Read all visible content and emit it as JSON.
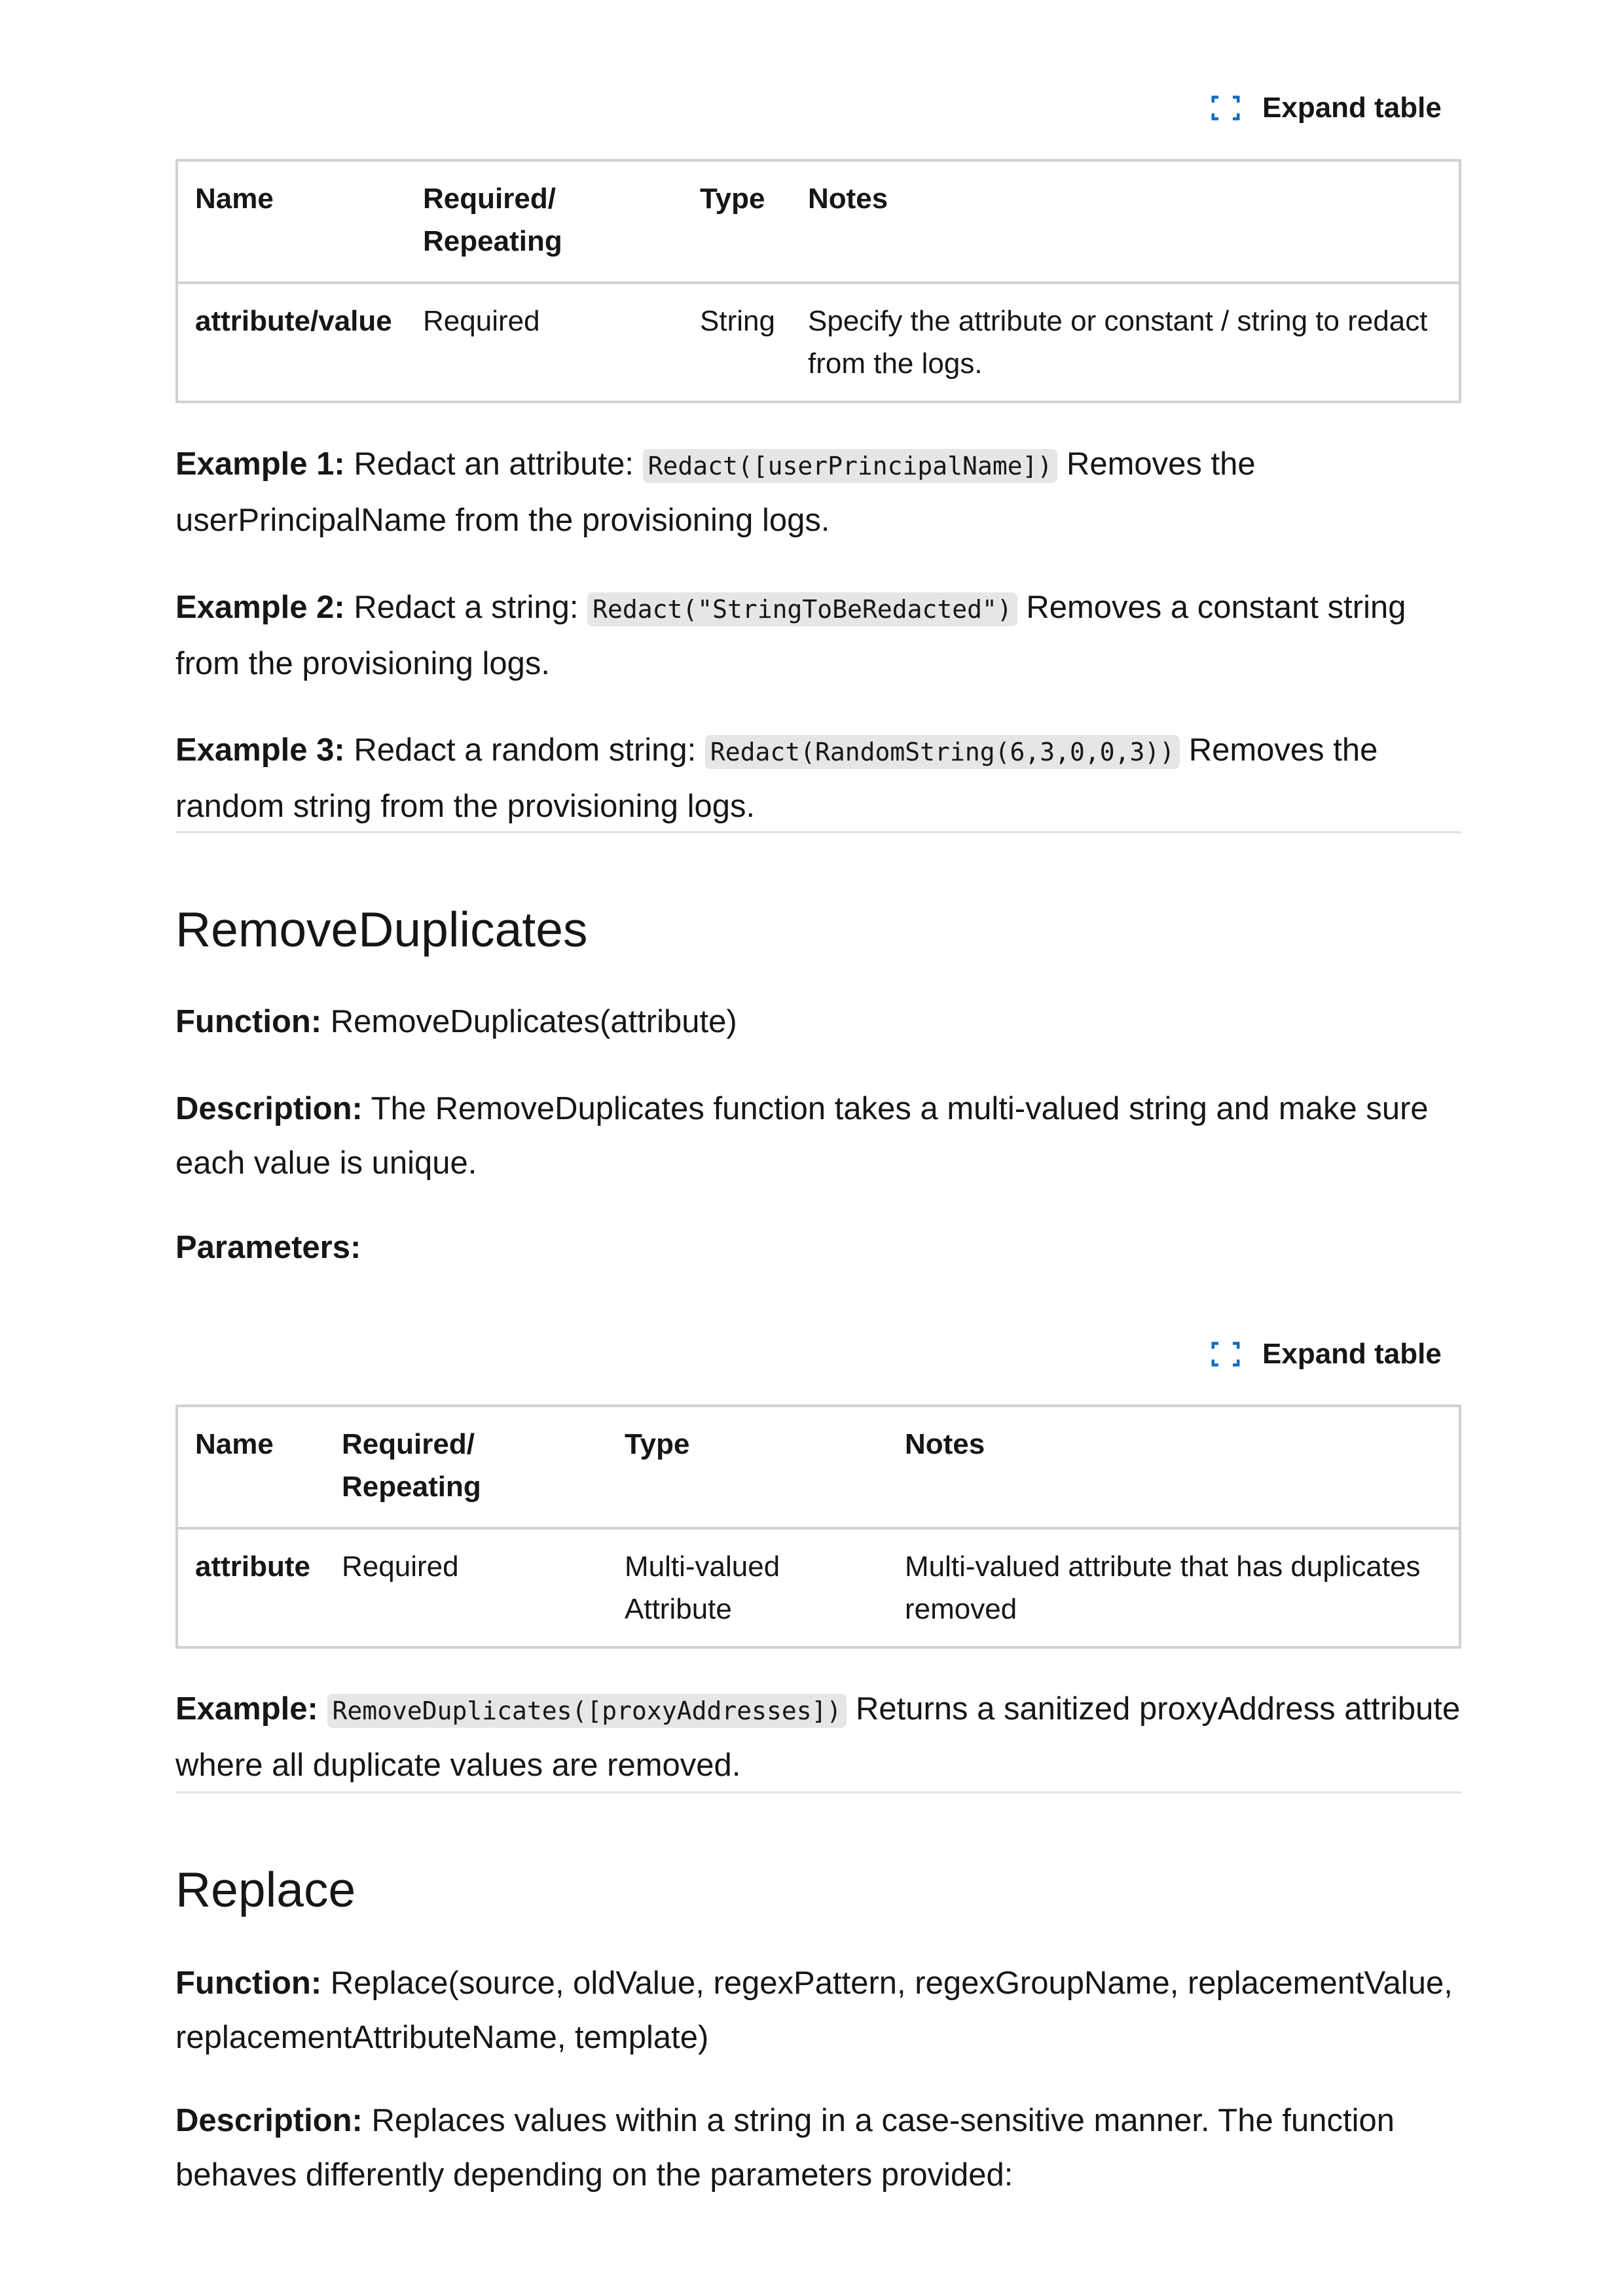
{
  "expand_label": "Expand table",
  "redact_table": {
    "headers": [
      "Name",
      "Required/ Repeating",
      "Type",
      "Notes"
    ],
    "rows": [
      [
        "attribute/value",
        "Required",
        "String",
        "Specify the attribute or constant / string to redact from the logs."
      ]
    ]
  },
  "redact_examples": [
    {
      "label": "Example 1:",
      "pre": " Redact an attribute: ",
      "code": "Redact([userPrincipalName])",
      "post": " Removes the userPrincipalName from the provisioning logs."
    },
    {
      "label": "Example 2:",
      "pre": " Redact a string: ",
      "code": "Redact(\"StringToBeRedacted\")",
      "post": " Removes a constant string from the provisioning logs."
    },
    {
      "label": "Example 3:",
      "pre": " Redact a random string: ",
      "code": "Redact(RandomString(6,3,0,0,3))",
      "post": " Removes the random string from the provisioning logs."
    }
  ],
  "remove_duplicates": {
    "title": "RemoveDuplicates",
    "function_label": "Function:",
    "function": " RemoveDuplicates(attribute)",
    "description_label": "Description:",
    "description": " The RemoveDuplicates function takes a multi-valued string and make sure each value is unique.",
    "parameters_label": "Parameters:",
    "table": {
      "headers": [
        "Name",
        "Required/ Repeating",
        "Type",
        "Notes"
      ],
      "rows": [
        [
          "attribute",
          "Required",
          "Multi-valued Attribute",
          "Multi-valued attribute that has duplicates removed"
        ]
      ]
    },
    "example_label": "Example:",
    "example_code": "RemoveDuplicates([proxyAddresses])",
    "example_post": " Returns a sanitized proxyAddress attribute where all duplicate values are removed."
  },
  "replace": {
    "title": "Replace",
    "function_label": "Function:",
    "function": " Replace(source, oldValue, regexPattern, regexGroupName, replacementValue, replacementAttributeName, template)",
    "description_label": "Description:",
    "description": " Replaces values within a string in a case-sensitive manner. The function behaves differently depending on the parameters provided:"
  }
}
